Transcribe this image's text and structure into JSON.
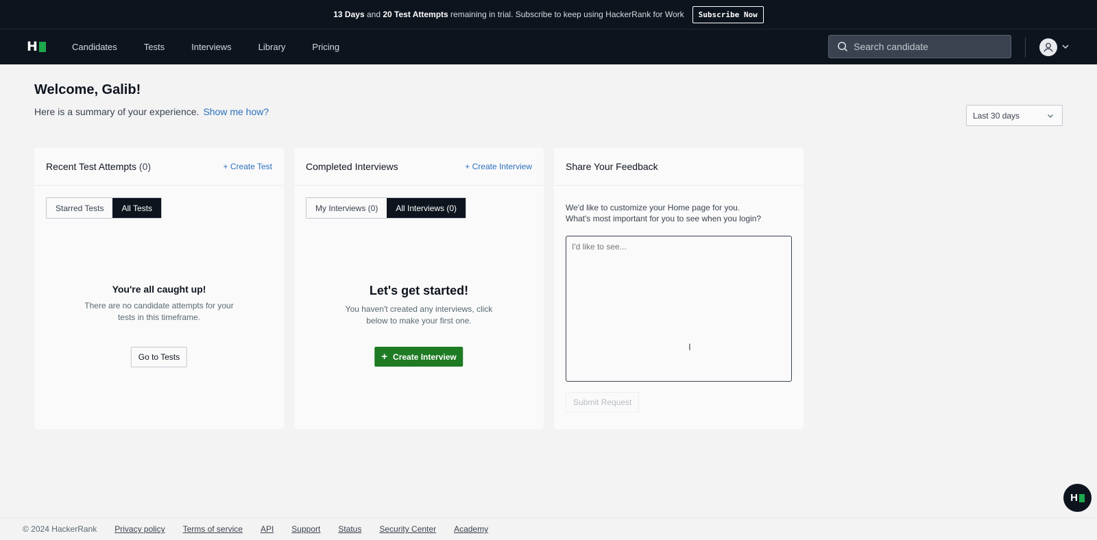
{
  "banner": {
    "days": "13 Days",
    "and": "and",
    "attempts": "20 Test Attempts",
    "rest": "remaining in trial. Subscribe to keep using HackerRank for Work",
    "button": "Subscribe Now"
  },
  "nav": {
    "logo_letter": "H",
    "links": [
      "Candidates",
      "Tests",
      "Interviews",
      "Library",
      "Pricing"
    ],
    "search_placeholder": "Search candidate"
  },
  "welcome": {
    "title": "Welcome, Galib!",
    "subtitle": "Here is a summary of your experience.",
    "link": "Show me how?"
  },
  "range": {
    "selected": "Last 30 days"
  },
  "tests_card": {
    "title": "Recent Test Attempts",
    "count": "(0)",
    "action": "+ Create Test",
    "tabs": [
      "Starred Tests",
      "All Tests"
    ],
    "empty_title": "You're all caught up!",
    "empty_text": "There are no candidate attempts for your tests in this timeframe.",
    "button": "Go to Tests"
  },
  "interviews_card": {
    "title": "Completed Interviews",
    "action": "+ Create Interview",
    "tabs": [
      "My Interviews (0)",
      "All Interviews (0)"
    ],
    "empty_title": "Let's get started!",
    "empty_text": "You haven't created any interviews, click below to make your first one.",
    "button": "Create Interview"
  },
  "feedback_card": {
    "title": "Share Your Feedback",
    "line1": "We'd like to customize your Home page for you.",
    "line2": "What's most important for you to see when you login?",
    "placeholder": "I'd like to see...",
    "button": "Submit Request"
  },
  "footer": {
    "copyright": "© 2024 HackerRank",
    "links": [
      "Privacy policy",
      "Terms of service",
      "API",
      "Support",
      "Status",
      "Security Center",
      "Academy"
    ]
  },
  "colors": {
    "brand_dark": "#0e141e",
    "brand_green": "#1ba94c",
    "button_green": "#1e7a23",
    "link_blue": "#2a6fbe"
  }
}
